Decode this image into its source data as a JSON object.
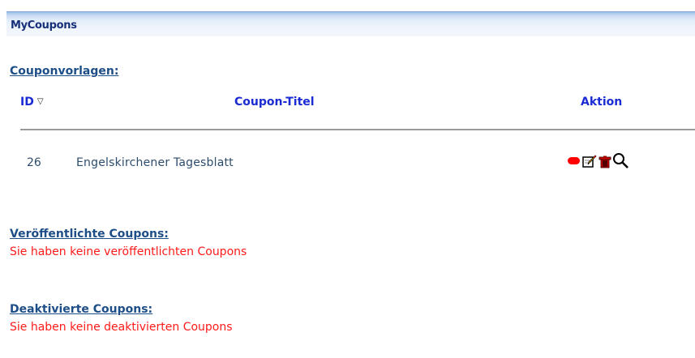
{
  "header": {
    "title": "MyCoupons"
  },
  "templates": {
    "heading": "Couponvorlagen:",
    "columns": {
      "id": "ID",
      "title": "Coupon-Titel",
      "action": "Aktion"
    },
    "rows": [
      {
        "id": "26",
        "title": "Engelskirchener Tagesblatt"
      }
    ],
    "actions": [
      {
        "icon": "status-red-pill-icon",
        "color": "#ff0000"
      },
      {
        "icon": "edit-icon"
      },
      {
        "icon": "trash-icon",
        "color": "#cc0000"
      },
      {
        "icon": "magnifier-icon"
      }
    ]
  },
  "published": {
    "heading": "Veröffentlichte Coupons:",
    "message": "Sie haben keine veröffentlichten Coupons"
  },
  "deactivated": {
    "heading": "Deaktivierte Coupons:",
    "message": "Sie haben keine deaktivierten Coupons"
  },
  "colors": {
    "link": "#1e4e87",
    "column_header": "#1b2bd3",
    "error": "#ff1a1a",
    "header_bar": "#c8dcf2"
  }
}
